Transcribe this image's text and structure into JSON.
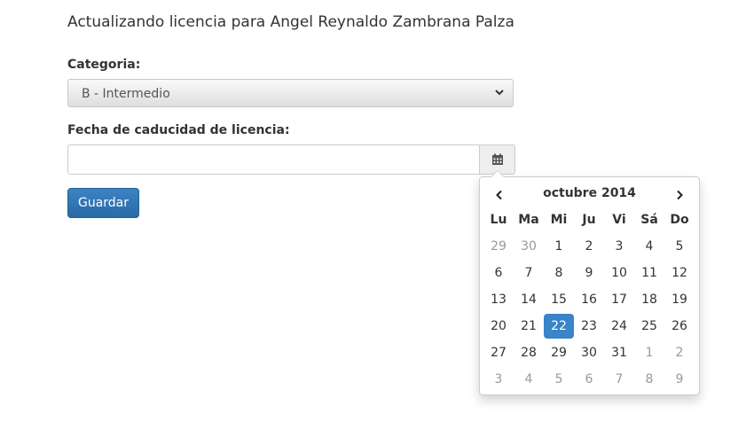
{
  "form": {
    "title": "Actualizando licencia para Angel Reynaldo Zambrana Palza",
    "category_label": "Categoria:",
    "category_selected": "B - Intermedio",
    "expiry_label": "Fecha de caducidad de licencia:",
    "expiry_value": "",
    "save_label": "Guardar"
  },
  "datepicker": {
    "month_label": "octubre 2014",
    "weekdays": [
      "Lu",
      "Ma",
      "Mi",
      "Ju",
      "Vi",
      "Sá",
      "Do"
    ],
    "selected_day": 22,
    "weeks": [
      [
        {
          "d": "29",
          "m": true
        },
        {
          "d": "30",
          "m": true
        },
        {
          "d": "1"
        },
        {
          "d": "2"
        },
        {
          "d": "3"
        },
        {
          "d": "4"
        },
        {
          "d": "5"
        }
      ],
      [
        {
          "d": "6"
        },
        {
          "d": "7"
        },
        {
          "d": "8"
        },
        {
          "d": "9"
        },
        {
          "d": "10"
        },
        {
          "d": "11"
        },
        {
          "d": "12"
        }
      ],
      [
        {
          "d": "13"
        },
        {
          "d": "14"
        },
        {
          "d": "15"
        },
        {
          "d": "16"
        },
        {
          "d": "17"
        },
        {
          "d": "18"
        },
        {
          "d": "19"
        }
      ],
      [
        {
          "d": "20"
        },
        {
          "d": "21"
        },
        {
          "d": "22",
          "a": true
        },
        {
          "d": "23"
        },
        {
          "d": "24"
        },
        {
          "d": "25"
        },
        {
          "d": "26"
        }
      ],
      [
        {
          "d": "27"
        },
        {
          "d": "28"
        },
        {
          "d": "29"
        },
        {
          "d": "30"
        },
        {
          "d": "31"
        },
        {
          "d": "1",
          "m": true
        },
        {
          "d": "2",
          "m": true
        }
      ],
      [
        {
          "d": "3",
          "m": true
        },
        {
          "d": "4",
          "m": true
        },
        {
          "d": "5",
          "m": true
        },
        {
          "d": "6",
          "m": true
        },
        {
          "d": "7",
          "m": true
        },
        {
          "d": "8",
          "m": true
        },
        {
          "d": "9",
          "m": true
        }
      ]
    ]
  },
  "colors": {
    "primary": "#3a84c8",
    "muted_text": "#999999"
  },
  "icons": {
    "select_arrow": "chevron-down-icon",
    "calendar": "calendar-icon",
    "prev": "chevron-left-icon",
    "next": "chevron-right-icon"
  }
}
